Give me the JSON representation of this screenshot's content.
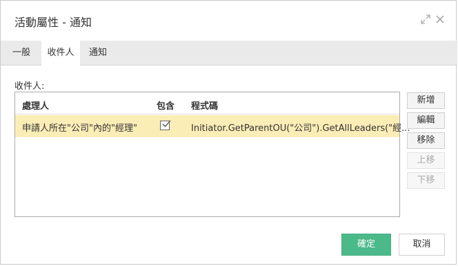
{
  "window": {
    "title": "活動屬性 - 通知",
    "maximize_icon": "expand-arrows-icon",
    "close_icon": "close-icon"
  },
  "tabs": [
    {
      "label": "一般",
      "active": false
    },
    {
      "label": "收件人",
      "active": true
    },
    {
      "label": "通知",
      "active": false
    }
  ],
  "recipients": {
    "label": "收件人:",
    "columns": {
      "handler": "處理人",
      "include": "包含",
      "code": "程式碼"
    },
    "rows": [
      {
        "handler": "申請人所在\"公司\"內的\"經理\"",
        "include": true,
        "code": "Initiator.GetParentOU(\"公司\").GetAllLeaders(\"經..."
      }
    ]
  },
  "side_buttons": {
    "add": "新增",
    "edit": "編輯",
    "remove": "移除",
    "move_up": "上移",
    "move_down": "下移"
  },
  "footer": {
    "ok": "確定",
    "cancel": "取消"
  },
  "colors": {
    "primary": "#4cb98a",
    "selected_row": "#fbedb6",
    "tab_bar": "#eaeaea"
  }
}
